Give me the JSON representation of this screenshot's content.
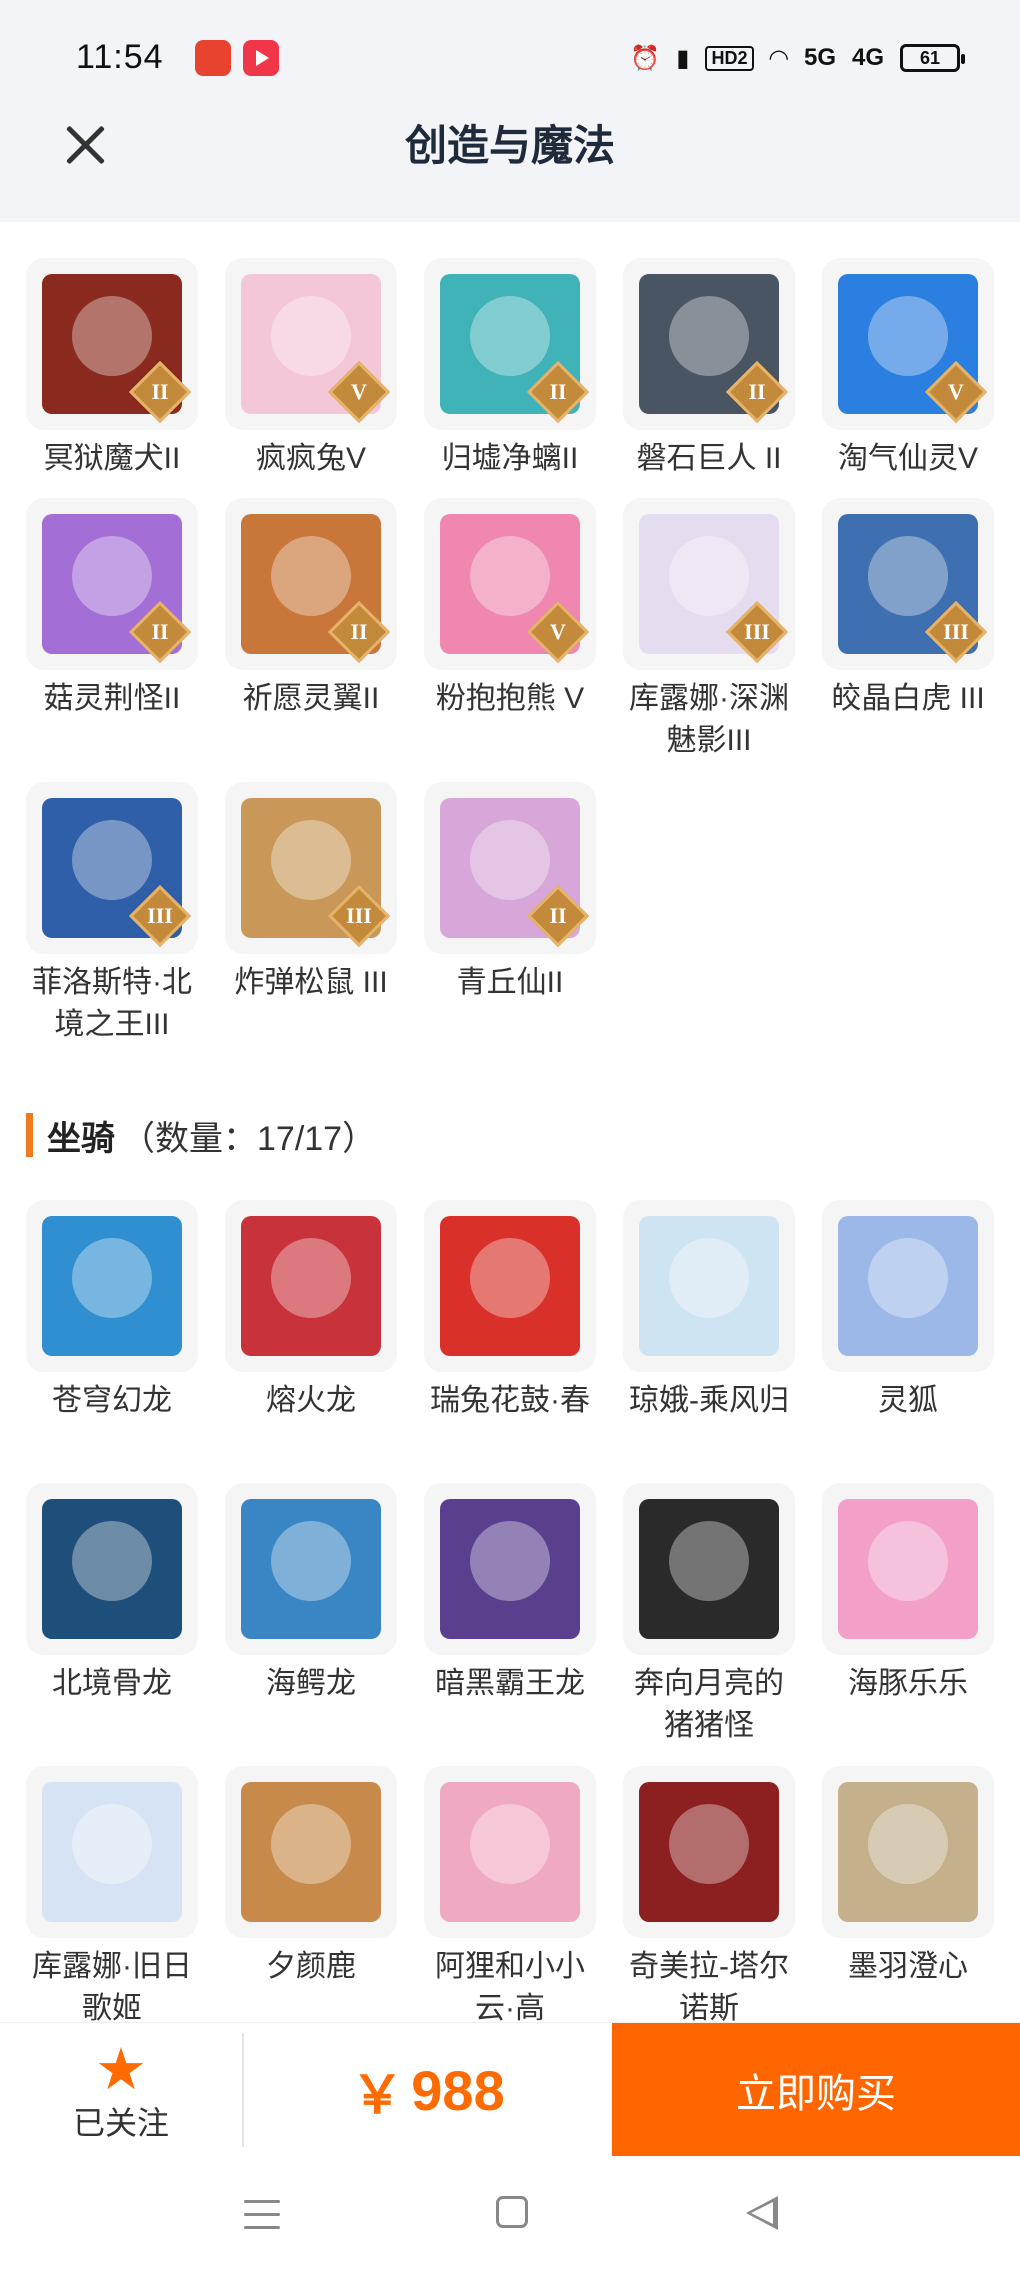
{
  "status_bar": {
    "time": "11:54",
    "icons": [
      "alarm-icon",
      "vibrate-icon",
      "hd-icon",
      "wifi-icon",
      "5g-signal-icon",
      "4g-signal-icon"
    ],
    "hd_label": "HD2",
    "sig5g": "5G",
    "sig4g": "4G",
    "battery": "61"
  },
  "header": {
    "title": "创造与魔法",
    "close_icon": "close-icon"
  },
  "pets": [
    {
      "name": "冥狱魔犬II",
      "tier": "II",
      "color": "#8a2a1e"
    },
    {
      "name": "疯疯兔V",
      "tier": "V",
      "color": "#f3c6d8"
    },
    {
      "name": "归墟净螭II",
      "tier": "II",
      "color": "#3fb3b8"
    },
    {
      "name": "磐石巨人 II",
      "tier": "II",
      "color": "#4a5563"
    },
    {
      "name": "淘气仙灵V",
      "tier": "V",
      "color": "#2b7fe0"
    },
    {
      "name": "菇灵荆怪II",
      "tier": "II",
      "color": "#a36fd6"
    },
    {
      "name": "祈愿灵翼II",
      "tier": "II",
      "color": "#c8763a"
    },
    {
      "name": "粉抱抱熊 V",
      "tier": "V",
      "color": "#ef87b0"
    },
    {
      "name": "库露娜·深渊魅影III",
      "tier": "III",
      "color": "#e6dcef"
    },
    {
      "name": "皎晶白虎 III",
      "tier": "III",
      "color": "#3e6fb0"
    },
    {
      "name": "菲洛斯特·北境之王III",
      "tier": "III",
      "color": "#2f5fa8"
    },
    {
      "name": "炸弹松鼠 III",
      "tier": "III",
      "color": "#c99858"
    },
    {
      "name": "青丘仙II",
      "tier": "II",
      "color": "#d8a7d9"
    }
  ],
  "mounts_section": {
    "title": "坐骑",
    "count_text": "（数量：17/17）"
  },
  "mounts": [
    {
      "name": "苍穹幻龙",
      "color": "#2f8fd0"
    },
    {
      "name": "熔火龙",
      "color": "#c8323a"
    },
    {
      "name": "瑞兔花鼓·春",
      "color": "#d9302a"
    },
    {
      "name": "琼娥-乘风归",
      "color": "#cfe4f2"
    },
    {
      "name": "灵狐",
      "color": "#9bb8e8"
    },
    {
      "name": "北境骨龙",
      "color": "#1e4f7a"
    },
    {
      "name": "海鳄龙",
      "color": "#3a86c4"
    },
    {
      "name": "暗黑霸王龙",
      "color": "#5a3f8f"
    },
    {
      "name": "奔向月亮的猪猪怪",
      "color": "#2a2a2a"
    },
    {
      "name": "海豚乐乐",
      "color": "#f2a0c8"
    },
    {
      "name": "库露娜·旧日歌姬",
      "color": "#d6e3f4"
    },
    {
      "name": "夕颜鹿",
      "color": "#c88a4a"
    },
    {
      "name": "阿狸和小小云·高",
      "color": "#f0a9c2"
    },
    {
      "name": "奇美拉-塔尔诺斯",
      "color": "#8c1f1f"
    },
    {
      "name": "墨羽澄心",
      "color": "#c4b08a"
    }
  ],
  "footer": {
    "follow_label": "已关注",
    "follow_icon": "star-icon",
    "currency": "￥",
    "price": "988",
    "buy_label": "立即购买"
  },
  "nav": {
    "icons": [
      "menu-icon",
      "home-icon",
      "back-icon"
    ]
  }
}
